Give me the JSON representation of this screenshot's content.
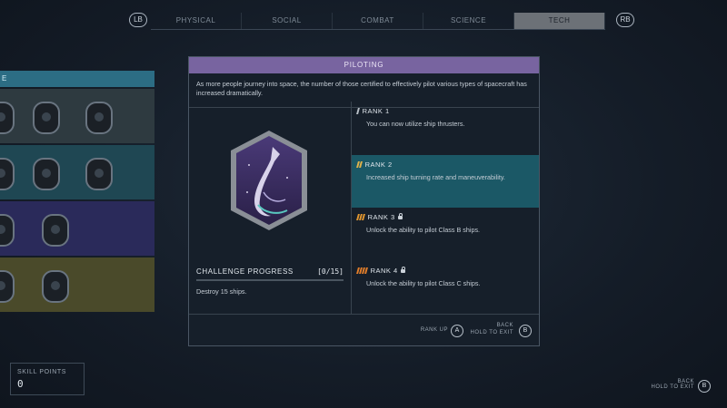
{
  "top_nav": {
    "lb": "LB",
    "rb": "RB",
    "tabs": [
      "PHYSICAL",
      "SOCIAL",
      "COMBAT",
      "SCIENCE",
      "TECH"
    ],
    "active_tab": "TECH"
  },
  "left_grid": {
    "header": "E"
  },
  "skill": {
    "title": "PILOTING",
    "description": "As more people journey into space, the number of those certified to effectively pilot various types of spacecraft has increased dramatically.",
    "challenge": {
      "title": "CHALLENGE PROGRESS",
      "count": "[0/15]",
      "progress": 0,
      "description": "Destroy 15 ships."
    },
    "ranks": [
      {
        "label": "RANK 1",
        "desc": "You can now utilize ship thrusters.",
        "locked": false,
        "color": "#b9c0c7"
      },
      {
        "label": "RANK 2",
        "desc": "Increased ship turning rate and maneuverability.",
        "locked": false,
        "color": "#e0b24a"
      },
      {
        "label": "RANK 3",
        "desc": "Unlock the ability to pilot Class B ships.",
        "locked": true,
        "color": "#e0962f"
      },
      {
        "label": "RANK 4",
        "desc": "Unlock the ability to pilot Class C ships.",
        "locked": true,
        "color": "#e07d2a"
      }
    ],
    "active_rank": 2
  },
  "footer": {
    "rank_up_label": "RANK UP",
    "rank_up_button": "A",
    "back_label": "BACK",
    "hold_label": "HOLD TO EXIT",
    "back_button": "B"
  },
  "skill_points": {
    "label": "SKILL POINTS",
    "value": "0"
  },
  "screen_back": {
    "back_label": "BACK",
    "hold_label": "HOLD TO EXIT",
    "button": "B"
  },
  "colors": {
    "title_bar": "#7864a0",
    "active_rank_bg": "#1b5866",
    "active_tab": "#6c7177"
  }
}
